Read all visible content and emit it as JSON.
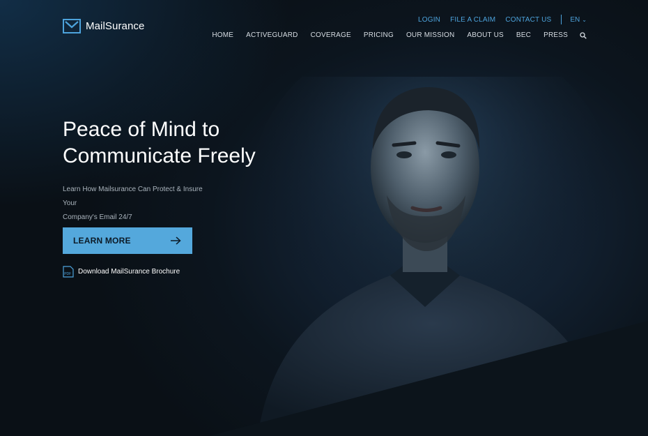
{
  "brand": {
    "name": "MailSurance",
    "icon": "envelope-icon"
  },
  "utility_nav": {
    "items": [
      "LOGIN",
      "FILE A CLAIM",
      "CONTACT US"
    ],
    "language": "EN"
  },
  "main_nav": {
    "items": [
      "HOME",
      "ACTIVEGUARD",
      "COVERAGE",
      "PRICING",
      "OUR MISSION",
      "ABOUT US",
      "BEC",
      "PRESS"
    ],
    "search_icon": "search-icon"
  },
  "hero": {
    "headline_line1": "Peace of Mind to",
    "headline_line2": "Communicate Freely",
    "subtext_line1": "Learn How Mailsurance Can Protect & Insure Your",
    "subtext_line2": "Company's Email 24/7",
    "cta_label": "LEARN MORE",
    "brochure_label": "Download MailSurance Brochure",
    "pdf_icon_text": "PDF"
  },
  "colors": {
    "accent": "#54a8dc",
    "link": "#4da3dc",
    "background": "#0b1218"
  }
}
